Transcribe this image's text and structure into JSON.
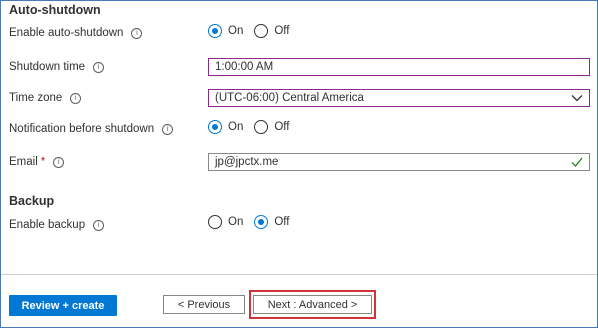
{
  "auto_shutdown": {
    "title": "Auto-shutdown",
    "enable": {
      "label": "Enable auto-shutdown",
      "on": "On",
      "off": "Off",
      "selected": "On"
    },
    "shutdown_time": {
      "label": "Shutdown time",
      "value": "1:00:00 AM"
    },
    "time_zone": {
      "label": "Time zone",
      "value": "(UTC-06:00) Central America"
    },
    "notification": {
      "label": "Notification before shutdown",
      "on": "On",
      "off": "Off",
      "selected": "On"
    },
    "email": {
      "label": "Email",
      "required_marker": "*",
      "value": "jp@jpctx.me"
    }
  },
  "backup": {
    "title": "Backup",
    "enable": {
      "label": "Enable backup",
      "on": "On",
      "off": "Off",
      "selected": "Off"
    }
  },
  "footer": {
    "review_create": "Review + create",
    "previous": "< Previous",
    "next": "Next : Advanced >"
  },
  "colors": {
    "accent": "#0078d4",
    "focus_border": "#8a2a8f",
    "highlight": "#d13438",
    "valid_check": "#107c10"
  }
}
